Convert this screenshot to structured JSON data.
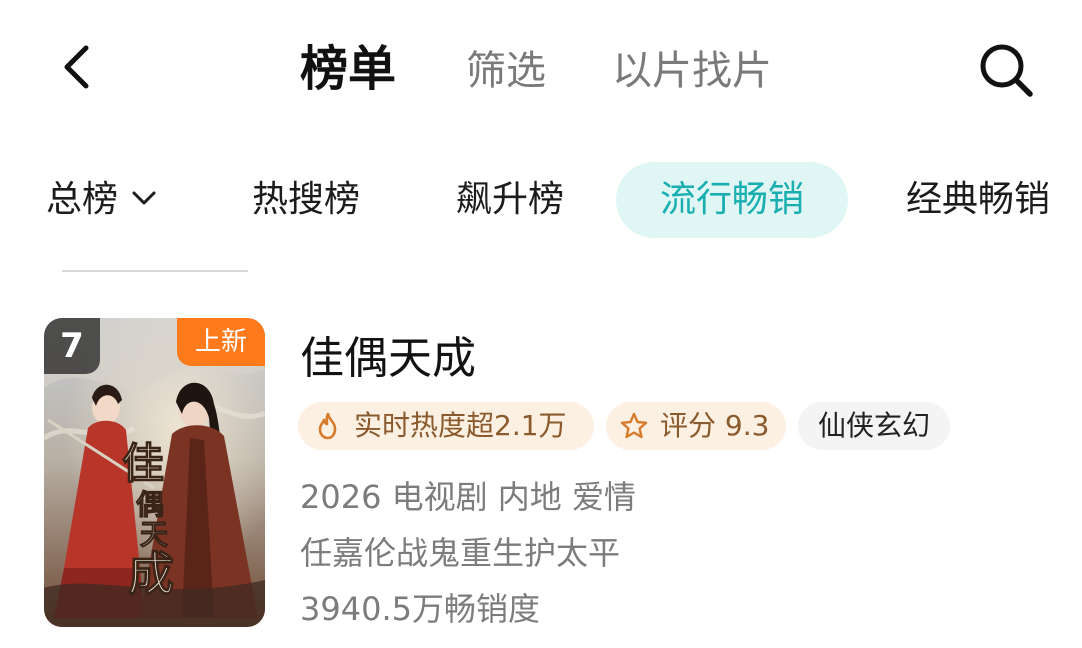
{
  "topbar": {
    "back_icon": "chevron-left-icon",
    "tabs": [
      {
        "label": "榜单",
        "active": true
      },
      {
        "label": "筛选",
        "active": false
      },
      {
        "label": "以片找片",
        "active": false
      }
    ],
    "search_icon": "search-icon"
  },
  "categories": [
    {
      "label": "总榜",
      "has_dropdown": true,
      "active": false
    },
    {
      "label": "热搜榜",
      "active": false
    },
    {
      "label": "飙升榜",
      "active": false
    },
    {
      "label": "流行畅销",
      "active": true
    },
    {
      "label": "经典畅销",
      "active": false
    }
  ],
  "colors": {
    "accent": "#19aeb0",
    "accent_bg": "#dff6f5",
    "new_badge": "#ff7a1a",
    "tag_bg": "#fcf0e2",
    "tag_text": "#8a5a2c"
  },
  "item": {
    "rank": "7",
    "badge": "上新",
    "title": "佳偶天成",
    "heat_label": "实时热度超2.1万",
    "heat_icon": "flame-icon",
    "score_label": "评分 9.3",
    "score_icon": "star-icon",
    "genre_tag": "仙侠玄幻",
    "meta_line1": "2026 电视剧 内地 爱情",
    "meta_line2": "任嘉伦战鬼重生护太平",
    "meta_line3": "3940.5万畅销度",
    "poster_title_text": "佳偶天成"
  }
}
